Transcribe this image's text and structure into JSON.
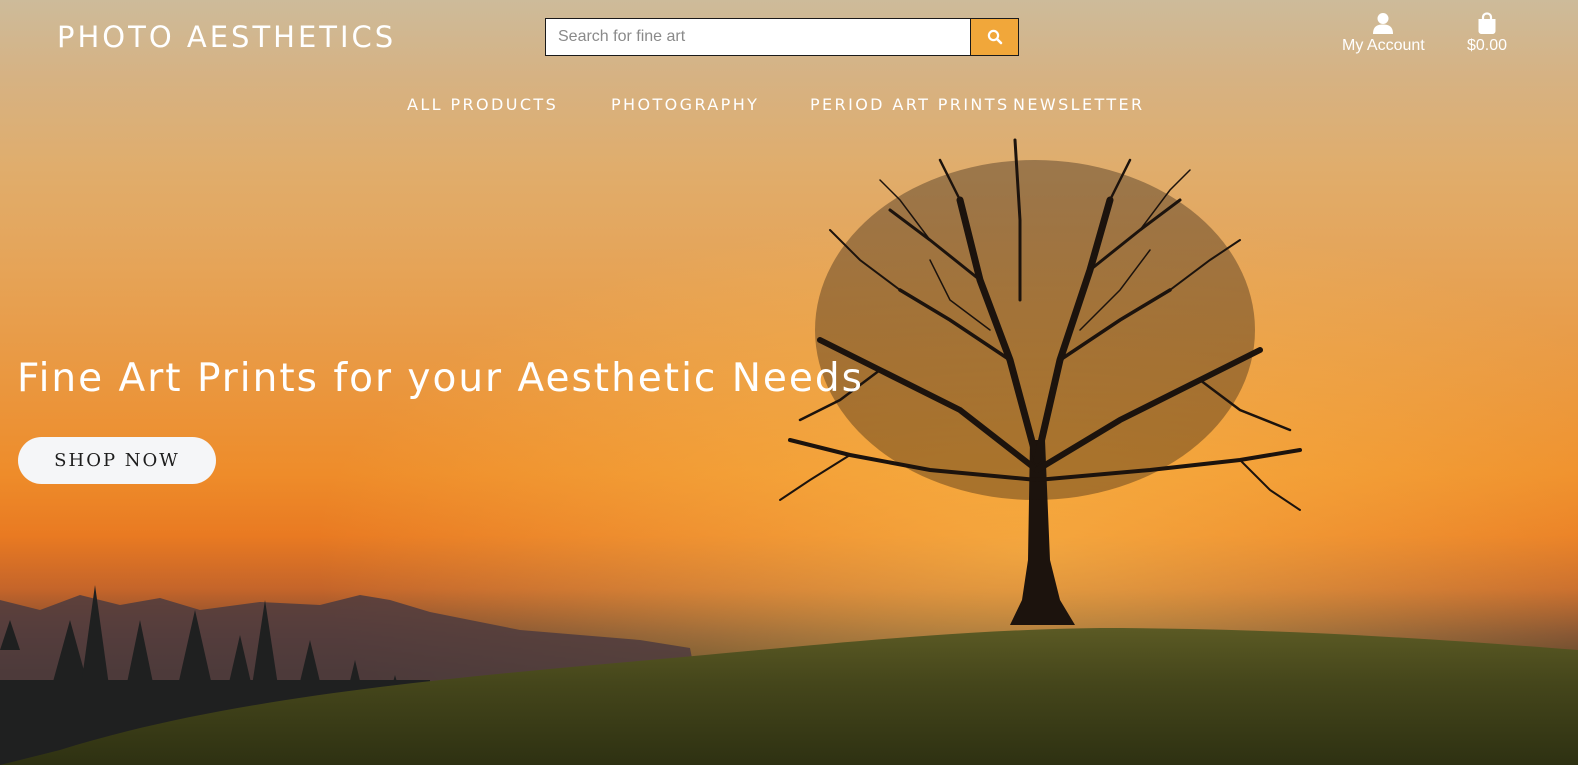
{
  "header": {
    "logo": "PHOTO AESTHETICS",
    "search": {
      "placeholder": "Search for fine art",
      "value": "",
      "button_icon": "search-icon"
    },
    "account": {
      "label": "My Account",
      "icon": "user-icon"
    },
    "cart": {
      "label": "$0.00",
      "icon": "shopping-bag-icon"
    }
  },
  "nav": {
    "items": [
      {
        "label": "ALL PRODUCTS"
      },
      {
        "label": "PHOTOGRAPHY"
      },
      {
        "label": "PERIOD ART PRINTS"
      },
      {
        "label": "NEWSLETTER"
      }
    ]
  },
  "hero": {
    "headline": "Fine Art Prints for your Aesthetic Needs",
    "cta_label": "SHOP NOW",
    "image": "tree-on-hill-sunset-photo"
  },
  "colors": {
    "accent": "#f1a73a",
    "text_light": "#ffffff",
    "button_bg": "#f5f6f8"
  }
}
